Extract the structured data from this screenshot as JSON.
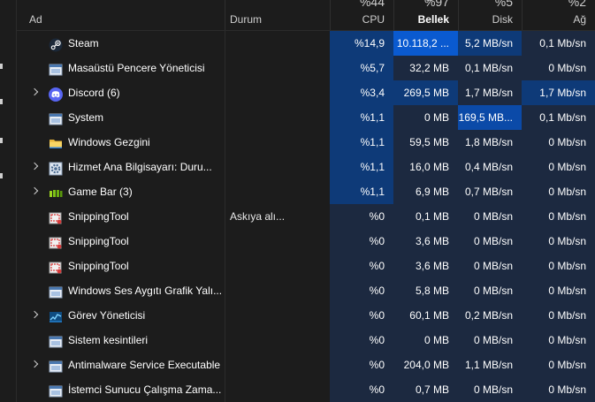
{
  "colors": {
    "heat_dark": "#1c2940",
    "heat_mid": "#0e3a78",
    "heat_strong": "#0b4aa8",
    "heat_max": "#0a5ad0",
    "background": "#1c1c1c"
  },
  "header": {
    "name_label": "Ad",
    "status_label": "Durum",
    "cpu_pct": "%44",
    "cpu_label": "CPU",
    "mem_pct": "%97",
    "mem_label": "Bellek",
    "disk_pct": "%5",
    "disk_label": "Disk",
    "net_pct": "%2",
    "net_label": "Ağ"
  },
  "rows": [
    {
      "name": "Steam",
      "icon": "steam-icon",
      "expandable": false,
      "status": "",
      "cpu": "%14,9",
      "mem": "10.118,2 ...",
      "disk": "5,2 MB/sn",
      "net": "0,1 Mb/sn",
      "heat": {
        "cpu": "heat_mid",
        "mem": "heat_max",
        "disk": "heat_mid",
        "net": "heat_dark"
      }
    },
    {
      "name": "Masaüstü Pencere Yöneticisi",
      "icon": "app-window-icon",
      "expandable": false,
      "status": "",
      "cpu": "%5,7",
      "mem": "32,2 MB",
      "disk": "0,1 MB/sn",
      "net": "0 Mb/sn",
      "heat": {
        "cpu": "heat_mid",
        "mem": "heat_dark",
        "disk": "heat_dark",
        "net": "heat_dark"
      }
    },
    {
      "name": "Discord (6)",
      "icon": "discord-icon",
      "expandable": true,
      "status": "",
      "cpu": "%3,4",
      "mem": "269,5 MB",
      "disk": "1,7 MB/sn",
      "net": "1,7 Mb/sn",
      "heat": {
        "cpu": "heat_mid",
        "mem": "heat_mid",
        "disk": "heat_dark",
        "net": "heat_mid"
      }
    },
    {
      "name": "System",
      "icon": "app-window-icon",
      "expandable": false,
      "status": "",
      "cpu": "%1,1",
      "mem": "0 MB",
      "disk": "169,5 MB...",
      "net": "0,1 Mb/sn",
      "heat": {
        "cpu": "heat_mid",
        "mem": "heat_dark",
        "disk": "heat_strong",
        "net": "heat_dark"
      }
    },
    {
      "name": "Windows Gezgini",
      "icon": "folder-icon",
      "expandable": false,
      "status": "",
      "cpu": "%1,1",
      "mem": "59,5 MB",
      "disk": "1,8 MB/sn",
      "net": "0 Mb/sn",
      "heat": {
        "cpu": "heat_mid",
        "mem": "heat_dark",
        "disk": "heat_dark",
        "net": "heat_dark"
      }
    },
    {
      "name": "Hizmet Ana Bilgisayarı: Duru...",
      "icon": "gear-icon",
      "expandable": true,
      "status": "",
      "cpu": "%1,1",
      "mem": "16,0 MB",
      "disk": "0,4 MB/sn",
      "net": "0 Mb/sn",
      "heat": {
        "cpu": "heat_mid",
        "mem": "heat_dark",
        "disk": "heat_dark",
        "net": "heat_dark"
      }
    },
    {
      "name": "Game Bar (3)",
      "icon": "game-bar-icon",
      "expandable": true,
      "status": "",
      "cpu": "%1,1",
      "mem": "6,9 MB",
      "disk": "0,7 MB/sn",
      "net": "0 Mb/sn",
      "heat": {
        "cpu": "heat_mid",
        "mem": "heat_dark",
        "disk": "heat_dark",
        "net": "heat_dark"
      }
    },
    {
      "name": "SnippingTool",
      "icon": "snipping-tool-icon",
      "expandable": false,
      "status": "Askıya alı...",
      "cpu": "%0",
      "mem": "0,1 MB",
      "disk": "0 MB/sn",
      "net": "0 Mb/sn",
      "heat": {
        "cpu": "heat_dark",
        "mem": "heat_dark",
        "disk": "heat_dark",
        "net": "heat_dark"
      }
    },
    {
      "name": "SnippingTool",
      "icon": "snipping-tool-icon",
      "expandable": false,
      "status": "",
      "cpu": "%0",
      "mem": "3,6 MB",
      "disk": "0 MB/sn",
      "net": "0 Mb/sn",
      "heat": {
        "cpu": "heat_dark",
        "mem": "heat_dark",
        "disk": "heat_dark",
        "net": "heat_dark"
      }
    },
    {
      "name": "SnippingTool",
      "icon": "snipping-tool-icon",
      "expandable": false,
      "status": "",
      "cpu": "%0",
      "mem": "3,6 MB",
      "disk": "0 MB/sn",
      "net": "0 Mb/sn",
      "heat": {
        "cpu": "heat_dark",
        "mem": "heat_dark",
        "disk": "heat_dark",
        "net": "heat_dark"
      }
    },
    {
      "name": "Windows Ses Aygıtı Grafik Yalı...",
      "icon": "app-window-icon",
      "expandable": false,
      "status": "",
      "cpu": "%0",
      "mem": "5,8 MB",
      "disk": "0 MB/sn",
      "net": "0 Mb/sn",
      "heat": {
        "cpu": "heat_dark",
        "mem": "heat_dark",
        "disk": "heat_dark",
        "net": "heat_dark"
      }
    },
    {
      "name": "Görev Yöneticisi",
      "icon": "task-manager-icon",
      "expandable": true,
      "status": "",
      "cpu": "%0",
      "mem": "60,1 MB",
      "disk": "0,2 MB/sn",
      "net": "0 Mb/sn",
      "heat": {
        "cpu": "heat_dark",
        "mem": "heat_dark",
        "disk": "heat_dark",
        "net": "heat_dark"
      }
    },
    {
      "name": "Sistem kesintileri",
      "icon": "app-window-icon",
      "expandable": false,
      "status": "",
      "cpu": "%0",
      "mem": "0 MB",
      "disk": "0 MB/sn",
      "net": "0 Mb/sn",
      "heat": {
        "cpu": "heat_dark",
        "mem": "heat_dark",
        "disk": "heat_dark",
        "net": "heat_dark"
      }
    },
    {
      "name": "Antimalware Service Executable",
      "icon": "app-window-icon",
      "expandable": true,
      "status": "",
      "cpu": "%0",
      "mem": "204,0 MB",
      "disk": "1,1 MB/sn",
      "net": "0 Mb/sn",
      "heat": {
        "cpu": "heat_dark",
        "mem": "heat_dark",
        "disk": "heat_dark",
        "net": "heat_dark"
      }
    },
    {
      "name": "İstemci Sunucu Çalışma Zama...",
      "icon": "app-window-icon",
      "expandable": false,
      "status": "",
      "cpu": "%0",
      "mem": "0,7 MB",
      "disk": "0 MB/sn",
      "net": "0 Mb/sn",
      "heat": {
        "cpu": "heat_dark",
        "mem": "heat_dark",
        "disk": "heat_dark",
        "net": "heat_dark"
      }
    }
  ]
}
